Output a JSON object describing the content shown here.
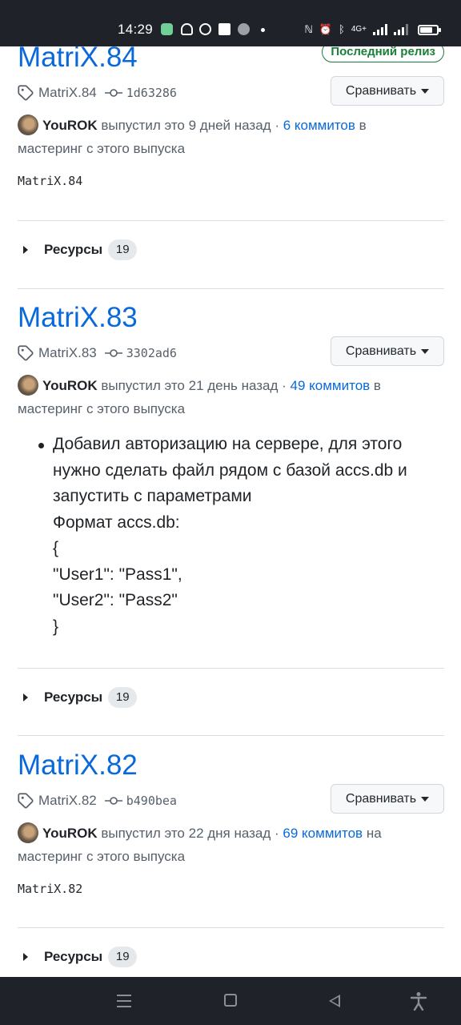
{
  "status_bar": {
    "time": "14:29",
    "network_label": "4G+",
    "battery_level": 0.75
  },
  "releases": [
    {
      "title": "MatriX.84",
      "latest_badge": "Последний релиз",
      "tag": "MatriX.84",
      "sha": "1d63286",
      "compare_label": "Сравнивать",
      "author": "YouROK",
      "released_text": " выпустил это 9 дней назад · ",
      "commits_link": "6 коммитов",
      "commits_suffix": " в",
      "branch_text": "мастеринг с этого выпуска",
      "body": "MatriX.84",
      "assets_label": "Ресурсы",
      "assets_count": "19"
    },
    {
      "title": "MatriX.83",
      "tag": "MatriX.83",
      "sha": "3302ad6",
      "compare_label": "Сравнивать",
      "author": "YouROK",
      "released_text": " выпустил это 21 день назад · ",
      "commits_link": "49 коммитов",
      "commits_suffix": " в",
      "branch_text": "мастеринг с этого выпуска",
      "notes": [
        "Добавил авторизацию на сервере, для этого",
        "нужно сделать файл рядом с базой accs.db и",
        "запустить с параметрами",
        "Формат accs.db:",
        "{",
        "\"User1\": \"Pass1\",",
        "\"User2\": \"Pass2\"",
        "}"
      ],
      "assets_label": "Ресурсы",
      "assets_count": "19"
    },
    {
      "title": "MatriX.82",
      "tag": "MatriX.82",
      "sha": "b490bea",
      "compare_label": "Сравнивать",
      "author": "YouROK",
      "released_text": " выпустил это 22 дня назад · ",
      "commits_link": "69 коммитов",
      "commits_suffix": " на",
      "branch_text": "мастеринг с этого выпуска",
      "body": "MatriX.82",
      "assets_label": "Ресурсы",
      "assets_count": "19"
    }
  ]
}
